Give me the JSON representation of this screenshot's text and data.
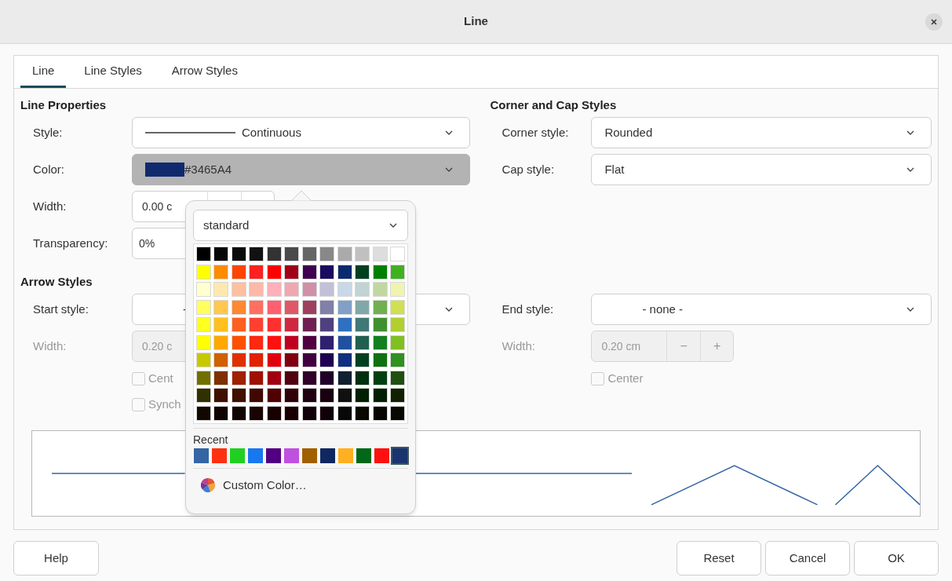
{
  "window": {
    "title": "Line"
  },
  "tabs": [
    {
      "label": "Line",
      "selected": true
    },
    {
      "label": "Line Styles",
      "selected": false
    },
    {
      "label": "Arrow Styles",
      "selected": false
    }
  ],
  "line_properties": {
    "heading": "Line Properties",
    "style": {
      "label": "Style:",
      "value": "Continuous"
    },
    "color": {
      "label": "Color:",
      "value": "#3465A4",
      "color": "#102a6e",
      "expanded": true
    },
    "width": {
      "label": "Width:",
      "value": "0.00 c"
    },
    "transparency": {
      "label": "Transparency:",
      "value": "0%"
    }
  },
  "arrow_styles": {
    "heading": "Arrow Styles",
    "start_style": {
      "label": "Start style:",
      "value": "-"
    },
    "width": {
      "label": "Width:",
      "value": "0.20 c",
      "disabled": true
    },
    "center": {
      "label": "Cent",
      "checked": false,
      "disabled": true
    },
    "synchronize": {
      "label": "Synch",
      "checked": false,
      "disabled": true
    }
  },
  "corner_cap": {
    "heading": "Corner and Cap Styles",
    "corner_style": {
      "label": "Corner style:",
      "value": "Rounded"
    },
    "cap_style": {
      "label": "Cap style:",
      "value": "Flat"
    }
  },
  "end_arrow": {
    "end_style": {
      "label": "End style:",
      "value": "- none -"
    },
    "width": {
      "label": "Width:",
      "value": "0.20 cm",
      "minus": "−",
      "plus": "+",
      "disabled": true
    },
    "center": {
      "label": "Center",
      "checked": false,
      "disabled": true
    }
  },
  "color_popup": {
    "palette": "standard",
    "swatches": [
      [
        {
          "color": "#000000"
        },
        {
          "color": "#060606"
        },
        {
          "color": "#0a0a0a"
        },
        {
          "color": "#111111"
        },
        {
          "color": "#333333"
        },
        {
          "color": "#4a4a4a"
        },
        {
          "color": "#666666"
        },
        {
          "color": "#888888"
        },
        {
          "color": "#aaaaaa"
        },
        {
          "color": "#c0c0c0"
        },
        {
          "color": "#dddddd"
        },
        {
          "color": "#ffffff"
        }
      ],
      [
        {
          "color": "#ffff00"
        },
        {
          "color": "#ff8c00"
        },
        {
          "color": "#ff4500"
        },
        {
          "color": "#ff2020"
        },
        {
          "color": "#ff0000"
        },
        {
          "color": "#a00018"
        },
        {
          "color": "#400050"
        },
        {
          "color": "#1a0a60"
        },
        {
          "color": "#0a2a70"
        },
        {
          "color": "#004020"
        },
        {
          "color": "#008000"
        },
        {
          "color": "#40b020"
        }
      ],
      [
        {
          "color": "#ffffd0"
        },
        {
          "color": "#ffe8b0"
        },
        {
          "color": "#ffc0a0"
        },
        {
          "color": "#ffb8a8"
        },
        {
          "color": "#ffb0b8"
        },
        {
          "color": "#f0a8b0"
        },
        {
          "color": "#d090a8"
        },
        {
          "color": "#c0c0d8"
        },
        {
          "color": "#c8d8e8"
        },
        {
          "color": "#c0d4d4"
        },
        {
          "color": "#c0d8a0"
        },
        {
          "color": "#f0f4b0"
        }
      ],
      [
        {
          "color": "#ffff60"
        },
        {
          "color": "#ffc850"
        },
        {
          "color": "#ff8830"
        },
        {
          "color": "#ff7060"
        },
        {
          "color": "#ff6070"
        },
        {
          "color": "#e05868"
        },
        {
          "color": "#a04060"
        },
        {
          "color": "#8080a8"
        },
        {
          "color": "#80a0c8"
        },
        {
          "color": "#80a8a8"
        },
        {
          "color": "#70b050"
        },
        {
          "color": "#d0e050"
        }
      ],
      [
        {
          "color": "#ffff20"
        },
        {
          "color": "#ffc020"
        },
        {
          "color": "#ff6020"
        },
        {
          "color": "#ff4030"
        },
        {
          "color": "#ff3030"
        },
        {
          "color": "#d02840"
        },
        {
          "color": "#702050"
        },
        {
          "color": "#504080"
        },
        {
          "color": "#3070c0"
        },
        {
          "color": "#407878"
        },
        {
          "color": "#409030"
        },
        {
          "color": "#b0d030"
        }
      ],
      [
        {
          "color": "#ffff01"
        },
        {
          "color": "#ffa800"
        },
        {
          "color": "#ff5000"
        },
        {
          "color": "#ff2810"
        },
        {
          "color": "#ff1010"
        },
        {
          "color": "#c00020"
        },
        {
          "color": "#500040"
        },
        {
          "color": "#302070"
        },
        {
          "color": "#2050a0"
        },
        {
          "color": "#206050"
        },
        {
          "color": "#108020"
        },
        {
          "color": "#80c020"
        }
      ],
      [
        {
          "color": "#c8c800"
        },
        {
          "color": "#d06000"
        },
        {
          "color": "#e03000"
        },
        {
          "color": "#e02000"
        },
        {
          "color": "#e00010"
        },
        {
          "color": "#800010"
        },
        {
          "color": "#400040"
        },
        {
          "color": "#200050"
        },
        {
          "color": "#103080"
        },
        {
          "color": "#004021"
        },
        {
          "color": "#107010"
        },
        {
          "color": "#309020"
        }
      ],
      [
        {
          "color": "#707000"
        },
        {
          "color": "#803000"
        },
        {
          "color": "#a02000"
        },
        {
          "color": "#a01000"
        },
        {
          "color": "#a00010"
        },
        {
          "color": "#500010"
        },
        {
          "color": "#300028"
        },
        {
          "color": "#200028"
        },
        {
          "color": "#102030"
        },
        {
          "color": "#003010"
        },
        {
          "color": "#004010"
        },
        {
          "color": "#205010"
        }
      ],
      [
        {
          "color": "#303000"
        },
        {
          "color": "#401000"
        },
        {
          "color": "#401001"
        },
        {
          "color": "#400800"
        },
        {
          "color": "#500000"
        },
        {
          "color": "#300008"
        },
        {
          "color": "#200010"
        },
        {
          "color": "#180010"
        },
        {
          "color": "#101010"
        },
        {
          "color": "#002000"
        },
        {
          "color": "#002001"
        },
        {
          "color": "#102000"
        }
      ],
      [
        {
          "color": "#100800"
        },
        {
          "color": "#100400"
        },
        {
          "color": "#100401"
        },
        {
          "color": "#180400"
        },
        {
          "color": "#180000"
        },
        {
          "color": "#180001"
        },
        {
          "color": "#100008"
        },
        {
          "color": "#100009"
        },
        {
          "color": "#080808"
        },
        {
          "color": "#080800"
        },
        {
          "color": "#080801"
        },
        {
          "color": "#080802"
        }
      ]
    ],
    "recent_label": "Recent",
    "recent": [
      {
        "color": "#3465a4",
        "selected": false
      },
      {
        "color": "#ff3010",
        "selected": false
      },
      {
        "color": "#20d020",
        "selected": false
      },
      {
        "color": "#1878f0",
        "selected": false
      },
      {
        "color": "#500080",
        "selected": false
      },
      {
        "color": "#c050e0",
        "selected": false
      },
      {
        "color": "#a06000",
        "selected": false
      },
      {
        "color": "#102860",
        "selected": false
      },
      {
        "color": "#ffb020",
        "selected": false
      },
      {
        "color": "#006818",
        "selected": false
      },
      {
        "color": "#ff1010",
        "selected": false
      },
      {
        "color": "#1a3470",
        "selected": true
      }
    ],
    "custom_color": "Custom Color…"
  },
  "buttons": {
    "help": "Help",
    "reset": "Reset",
    "cancel": "Cancel",
    "ok": "OK"
  }
}
